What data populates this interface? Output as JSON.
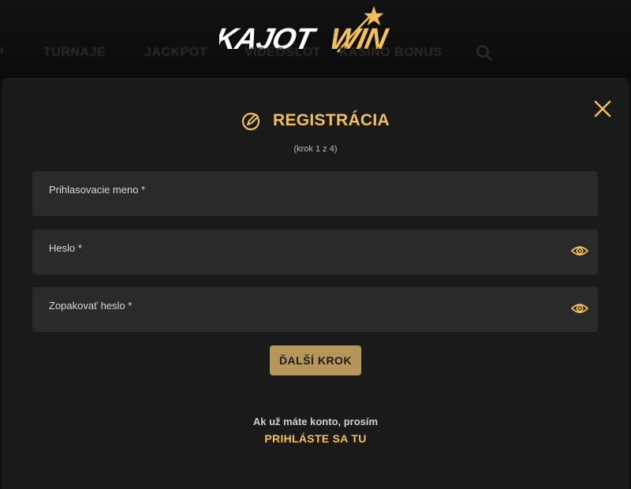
{
  "header": {
    "logo_text": "KAJOTWIN",
    "topline": "",
    "nav_items": [
      "P",
      "TURNAJE",
      "JACKPOT",
      "VIDEOSLOT",
      "KASINO BONUS"
    ]
  },
  "modal": {
    "title": "REGISTRÁCIA",
    "step": "(krok 1 z 4)",
    "fields": [
      {
        "label": "Prihlasovacie meno *",
        "value": "",
        "type": "text"
      },
      {
        "label": "Heslo *",
        "value": "",
        "type": "password"
      },
      {
        "label": "Zopakovať heslo *",
        "value": "",
        "type": "password"
      }
    ],
    "next_button": "ĎALŠÍ KROK",
    "login_prompt": "Ak už máte konto, prosím",
    "login_link": "PRIHLÁSTE SA TU"
  },
  "colors": {
    "accent": "#f2c05a",
    "button": "#b7965a",
    "modal_bg": "#1a1a1a",
    "field_bg": "#2a2a2a",
    "page_bg": "#0d0d0d"
  },
  "icons": {
    "close": "close-icon",
    "title": "edit-pencil-icon",
    "eye": "eye-icon",
    "search": "search-icon"
  }
}
